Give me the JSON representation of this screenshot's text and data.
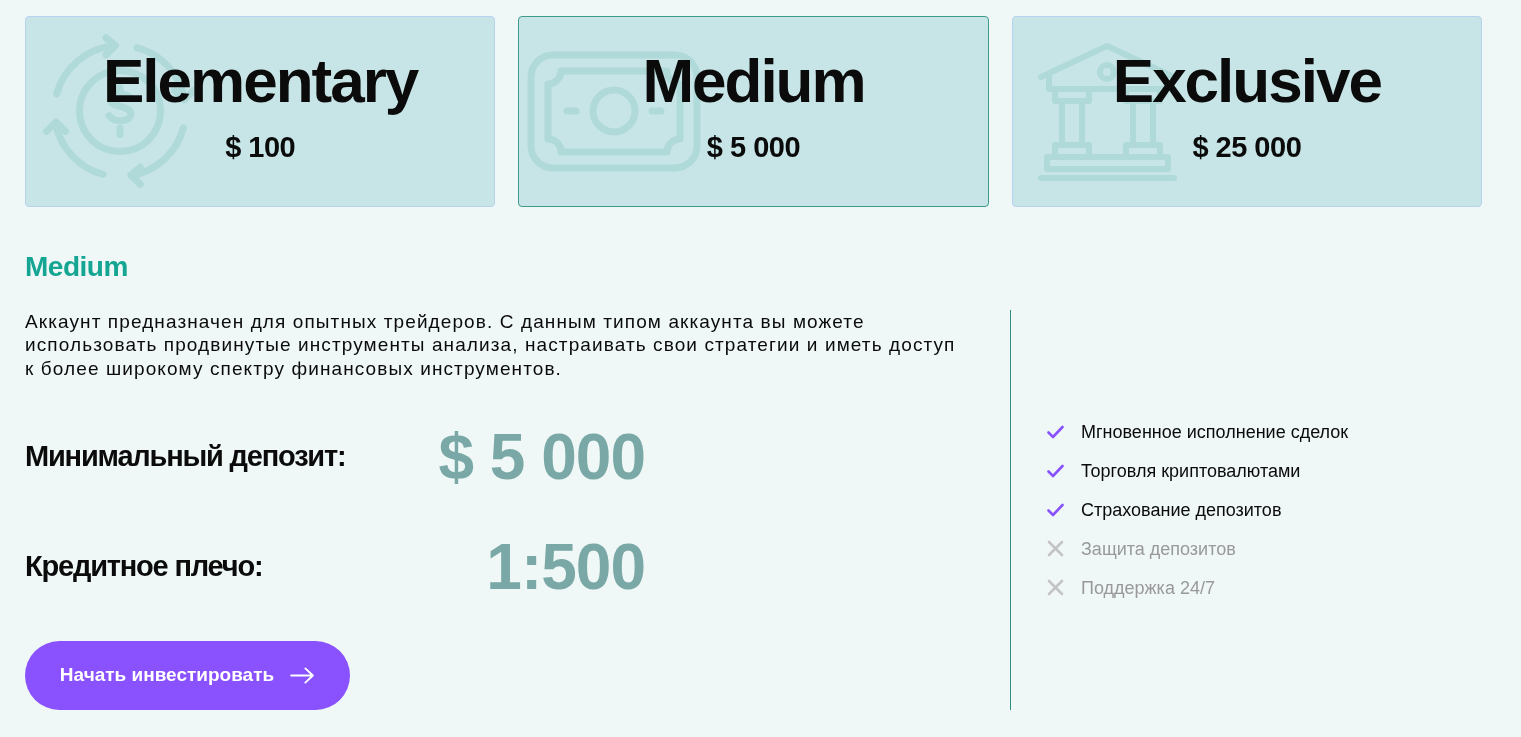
{
  "plans": [
    {
      "name": "Elementary",
      "price": "$ 100",
      "selected": false,
      "kind": "coin"
    },
    {
      "name": "Medium",
      "price": "$ 5 000",
      "selected": true,
      "kind": "banknote"
    },
    {
      "name": "Exclusive",
      "price": "$ 25 000",
      "selected": false,
      "kind": "bank"
    }
  ],
  "details": {
    "title": "Medium",
    "description": "Аккаунт предназначен для опытных трейдеров. С данным типом аккаунта вы можете использовать продвинутые инструменты анализа, настраивать свои стратегии и иметь доступ к более широкому спектру финансовых инструментов.",
    "stats": [
      {
        "label": "Минимальный депозит:",
        "value": "$ 5 000"
      },
      {
        "label": "Кредитное плечо:",
        "value": "1:500"
      }
    ],
    "button": "Начать инвестировать"
  },
  "features": [
    {
      "text": "Мгновенное исполнение сделок",
      "included": true
    },
    {
      "text": "Торговля криптовалютами",
      "included": true
    },
    {
      "text": "Страхование депозитов",
      "included": true
    },
    {
      "text": "Защита депозитов",
      "included": false
    },
    {
      "text": "Поддержка 24/7",
      "included": false
    }
  ]
}
